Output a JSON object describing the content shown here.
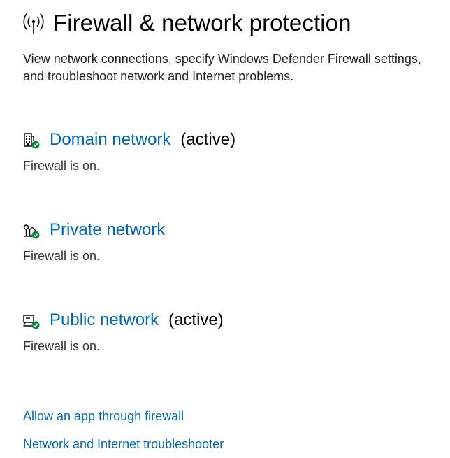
{
  "page": {
    "title": "Firewall & network protection",
    "description": "View network connections, specify Windows Defender Firewall settings, and troubleshoot network and Internet problems.",
    "icon": "wireless-antenna-icon"
  },
  "networks": [
    {
      "name": "Domain network",
      "active_label": "(active)",
      "status": "Firewall is on.",
      "icon": "domain-building-icon",
      "badge": "green-check"
    },
    {
      "name": "Private network",
      "active_label": "",
      "status": "Firewall is on.",
      "icon": "private-home-icon",
      "badge": "green-check"
    },
    {
      "name": "Public network",
      "active_label": "(active)",
      "status": "Firewall is on.",
      "icon": "public-cafe-icon",
      "badge": "green-check"
    }
  ],
  "links": {
    "allow_app": "Allow an app through firewall",
    "troubleshooter": "Network and Internet troubleshooter"
  },
  "colors": {
    "link": "#0067b8",
    "check": "#10893e",
    "text": "#000000",
    "secondary_text": "#333333"
  }
}
